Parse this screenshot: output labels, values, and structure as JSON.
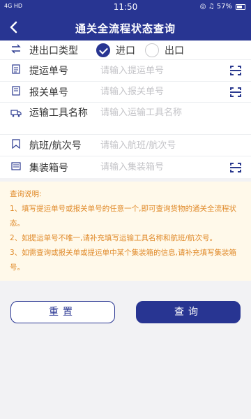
{
  "status_bar": {
    "signal": "4G HD",
    "time": "11:50",
    "right_icons": "◎ ♫ 57%"
  },
  "nav": {
    "title": "通关全流程状态查询"
  },
  "form": {
    "type": {
      "label": "进出口类型",
      "options": [
        {
          "label": "进口",
          "checked": true
        },
        {
          "label": "出口",
          "checked": false
        }
      ]
    },
    "bill_no": {
      "label": "提运单号",
      "placeholder": "请输入提运单号"
    },
    "declaration_no": {
      "label": "报关单号",
      "placeholder": "请输入报关单号"
    },
    "transport_name": {
      "label": "运输工具名称",
      "placeholder": "请输入运输工具名称"
    },
    "voyage": {
      "label": "航班/航次号",
      "placeholder": "请输入航班/航次号"
    },
    "container": {
      "label": "集装箱号",
      "placeholder": "请输入集装箱号"
    }
  },
  "notice": {
    "title": "查询说明:",
    "items": [
      "1、填写提运单号或报关单号的任意一个,即可查询货物的通关全流程状态。",
      "2、如提运单号不唯一,请补充填写运输工具名称和航班/航次号。",
      "3、如需查询或报关单或提运单中某个集装箱的信息,请补充填写集装箱号。"
    ]
  },
  "buttons": {
    "reset": "重置",
    "query": "查询"
  },
  "colors": {
    "primary": "#283592",
    "notice_text": "#e08a2a",
    "notice_bg": "#fff9ea"
  }
}
